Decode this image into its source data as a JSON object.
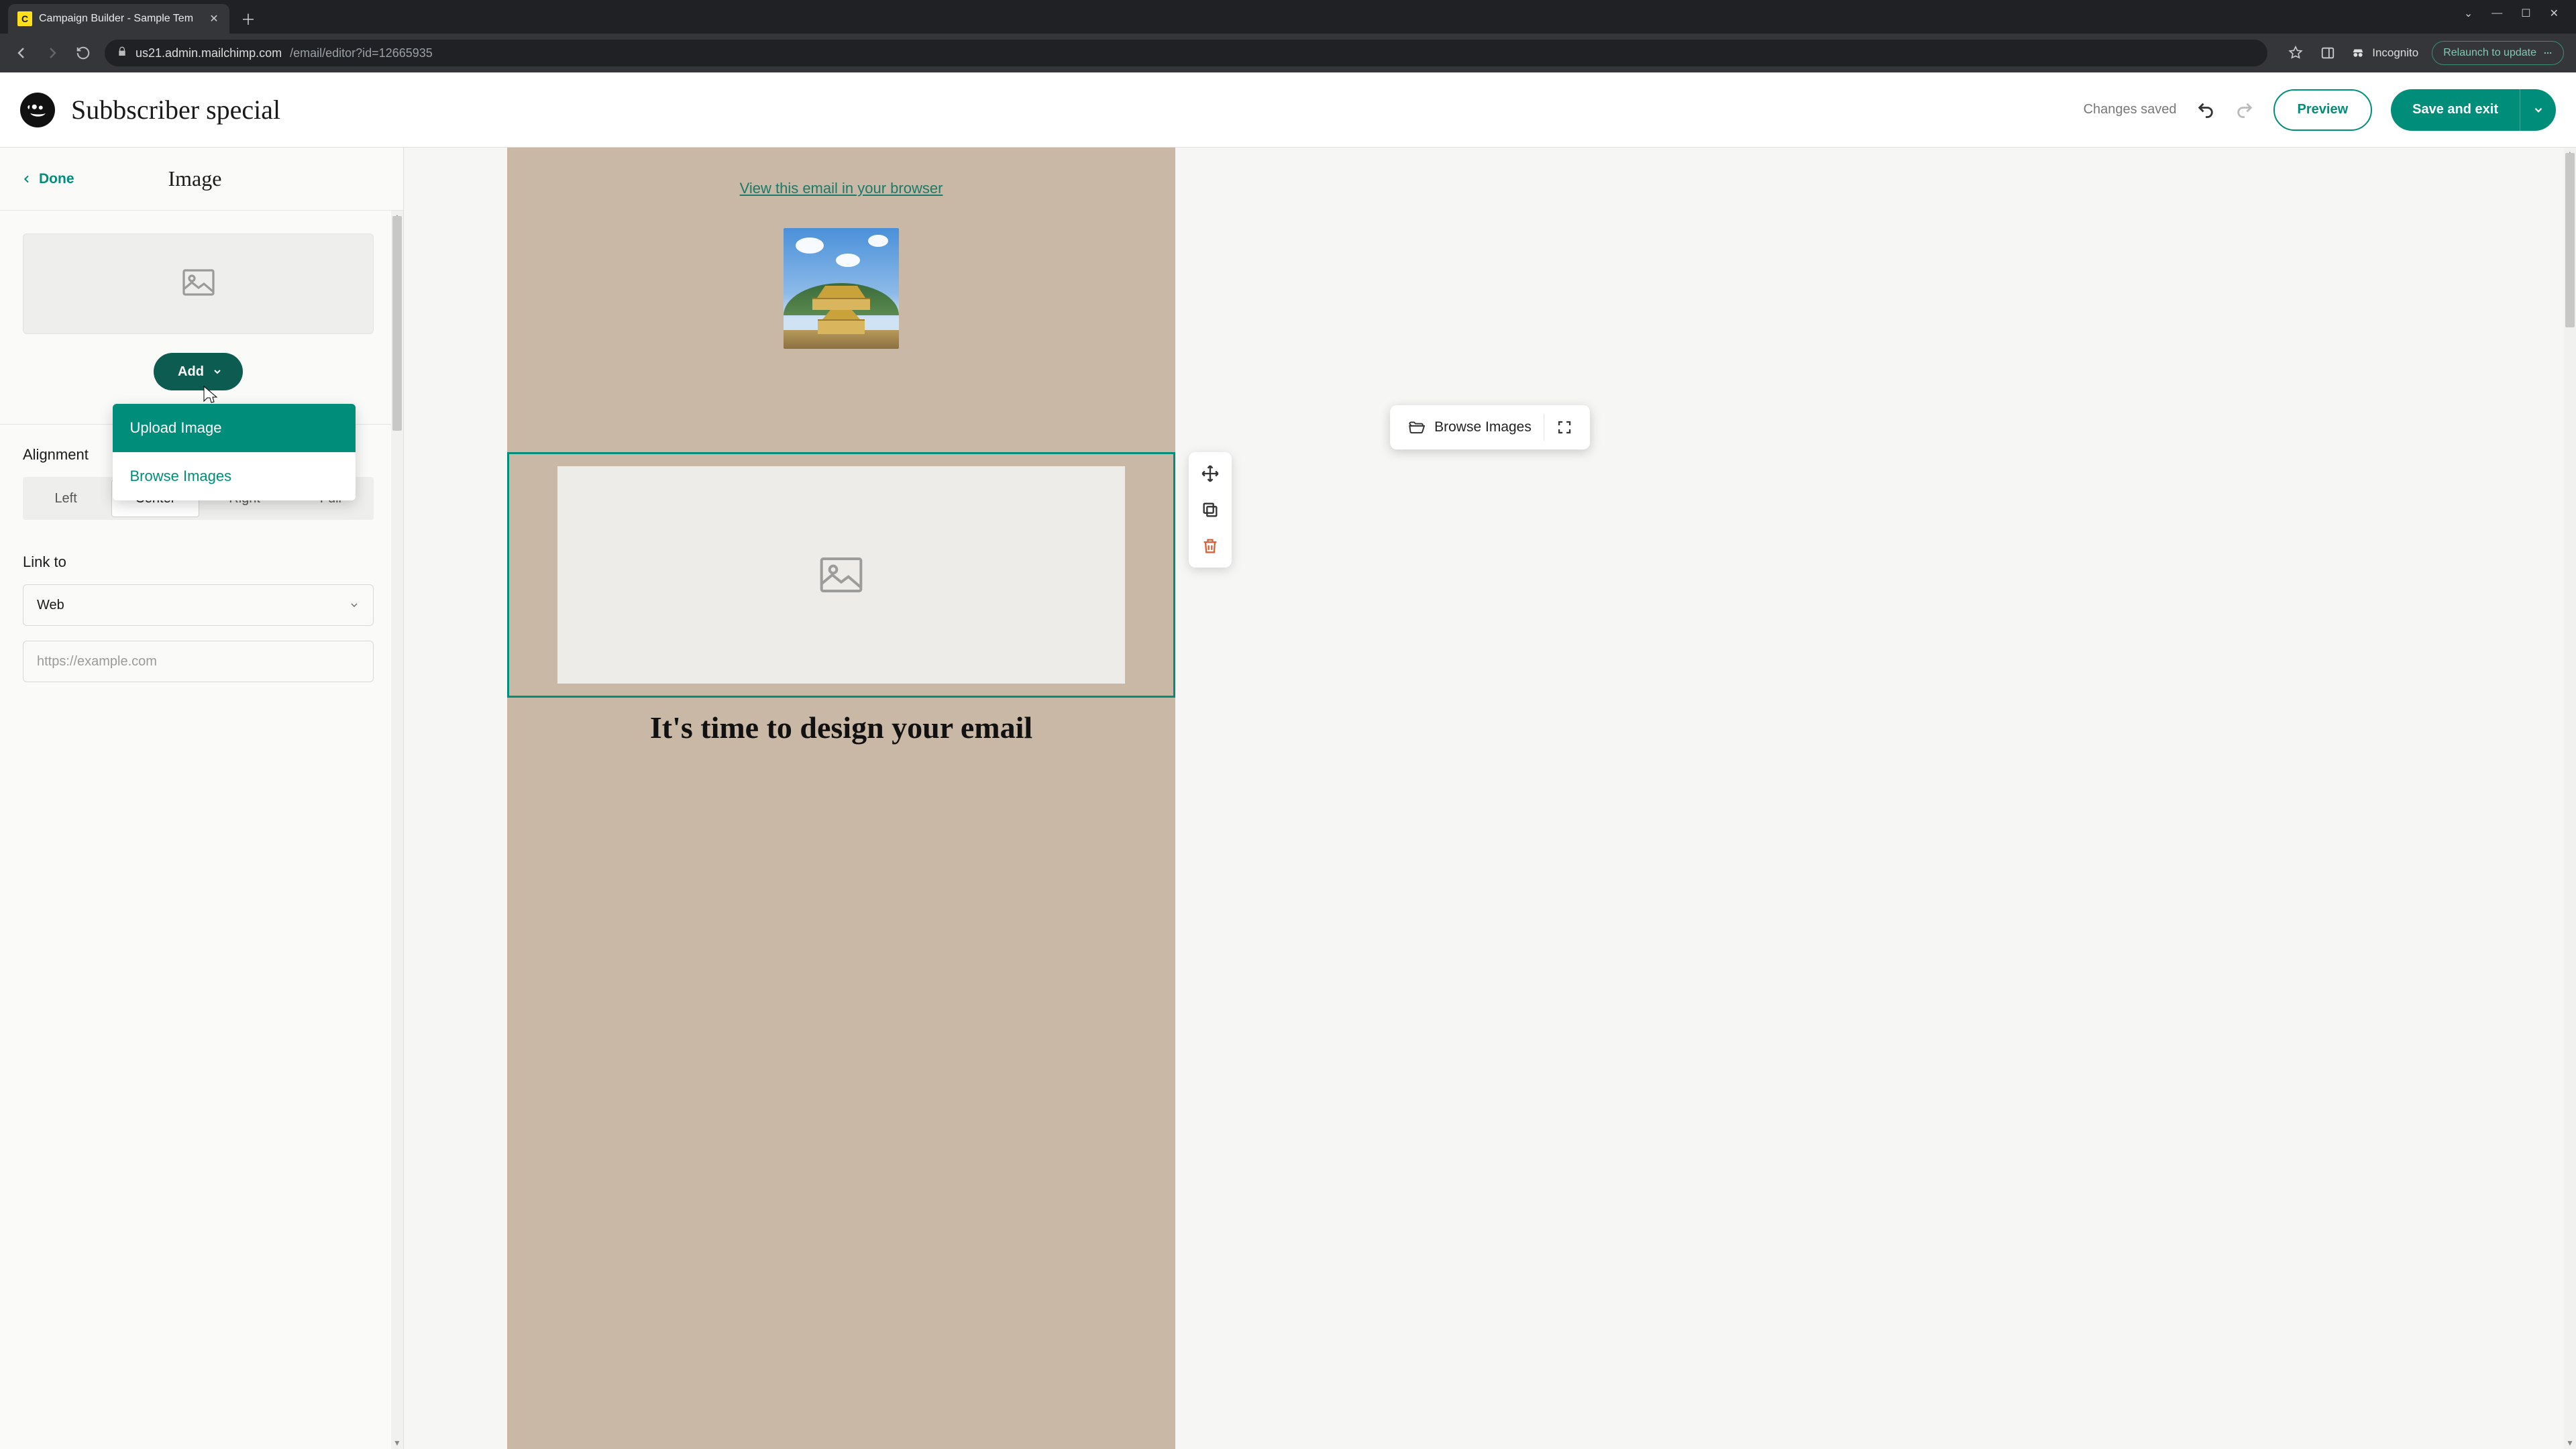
{
  "browser": {
    "tab_title": "Campaign Builder - Sample Tem",
    "url_host": "us21.admin.mailchimp.com",
    "url_path": "/email/editor?id=12665935",
    "incognito_label": "Incognito",
    "relaunch_label": "Relaunch to update"
  },
  "header": {
    "campaign_title": "Subbscriber special",
    "saved_status": "Changes saved",
    "preview_label": "Preview",
    "save_label": "Save and exit"
  },
  "sidebar": {
    "done_label": "Done",
    "panel_title": "Image",
    "add_button_label": "Add",
    "add_menu": {
      "upload": "Upload Image",
      "browse": "Browse Images"
    },
    "alignment": {
      "label": "Alignment",
      "options": {
        "left": "Left",
        "center": "Center",
        "right": "Right",
        "full": "Full"
      },
      "selected": "center"
    },
    "link_to": {
      "label": "Link to",
      "select_value": "Web",
      "url_placeholder": "https://example.com"
    }
  },
  "canvas": {
    "view_browser_link": "View this email in your browser",
    "floating_bar": {
      "browse_label": "Browse Images"
    },
    "headline": "It's time to design your email"
  }
}
